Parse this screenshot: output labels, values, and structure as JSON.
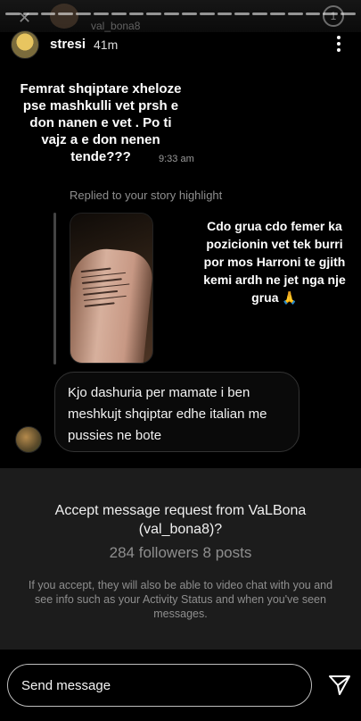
{
  "ghost_header": {
    "username": "val_bona8"
  },
  "header": {
    "username": "stresi",
    "time": "41m"
  },
  "story_caption_left": "Femrat shqiptare xheloze pse mashkulli vet prsh e don nanen e vet . Po ti vajz a e don nenen tende???",
  "message_time": "9:33 am",
  "replied_label": "Replied to your story highlight",
  "story_caption_right": "Cdo grua cdo femer ka pozicionin vet tek burri por mos Harroni te gjith kemi ardh ne jet nga nje grua 🙏",
  "reply_message": "Kjo dashuria per mamate i ben meshkujt shqiptar edhe italian me pussies ne bote",
  "request": {
    "title": "Accept message request from VaLBona (val_bona8)?",
    "stats": "284 followers 8 posts",
    "note": "If you accept, they will also be able to video chat with you and see info such as your Activity Status and when you've seen messages."
  },
  "composer": {
    "placeholder": "Send message"
  },
  "icons": {
    "more": "more-vertical-icon",
    "send": "paper-plane-icon"
  }
}
